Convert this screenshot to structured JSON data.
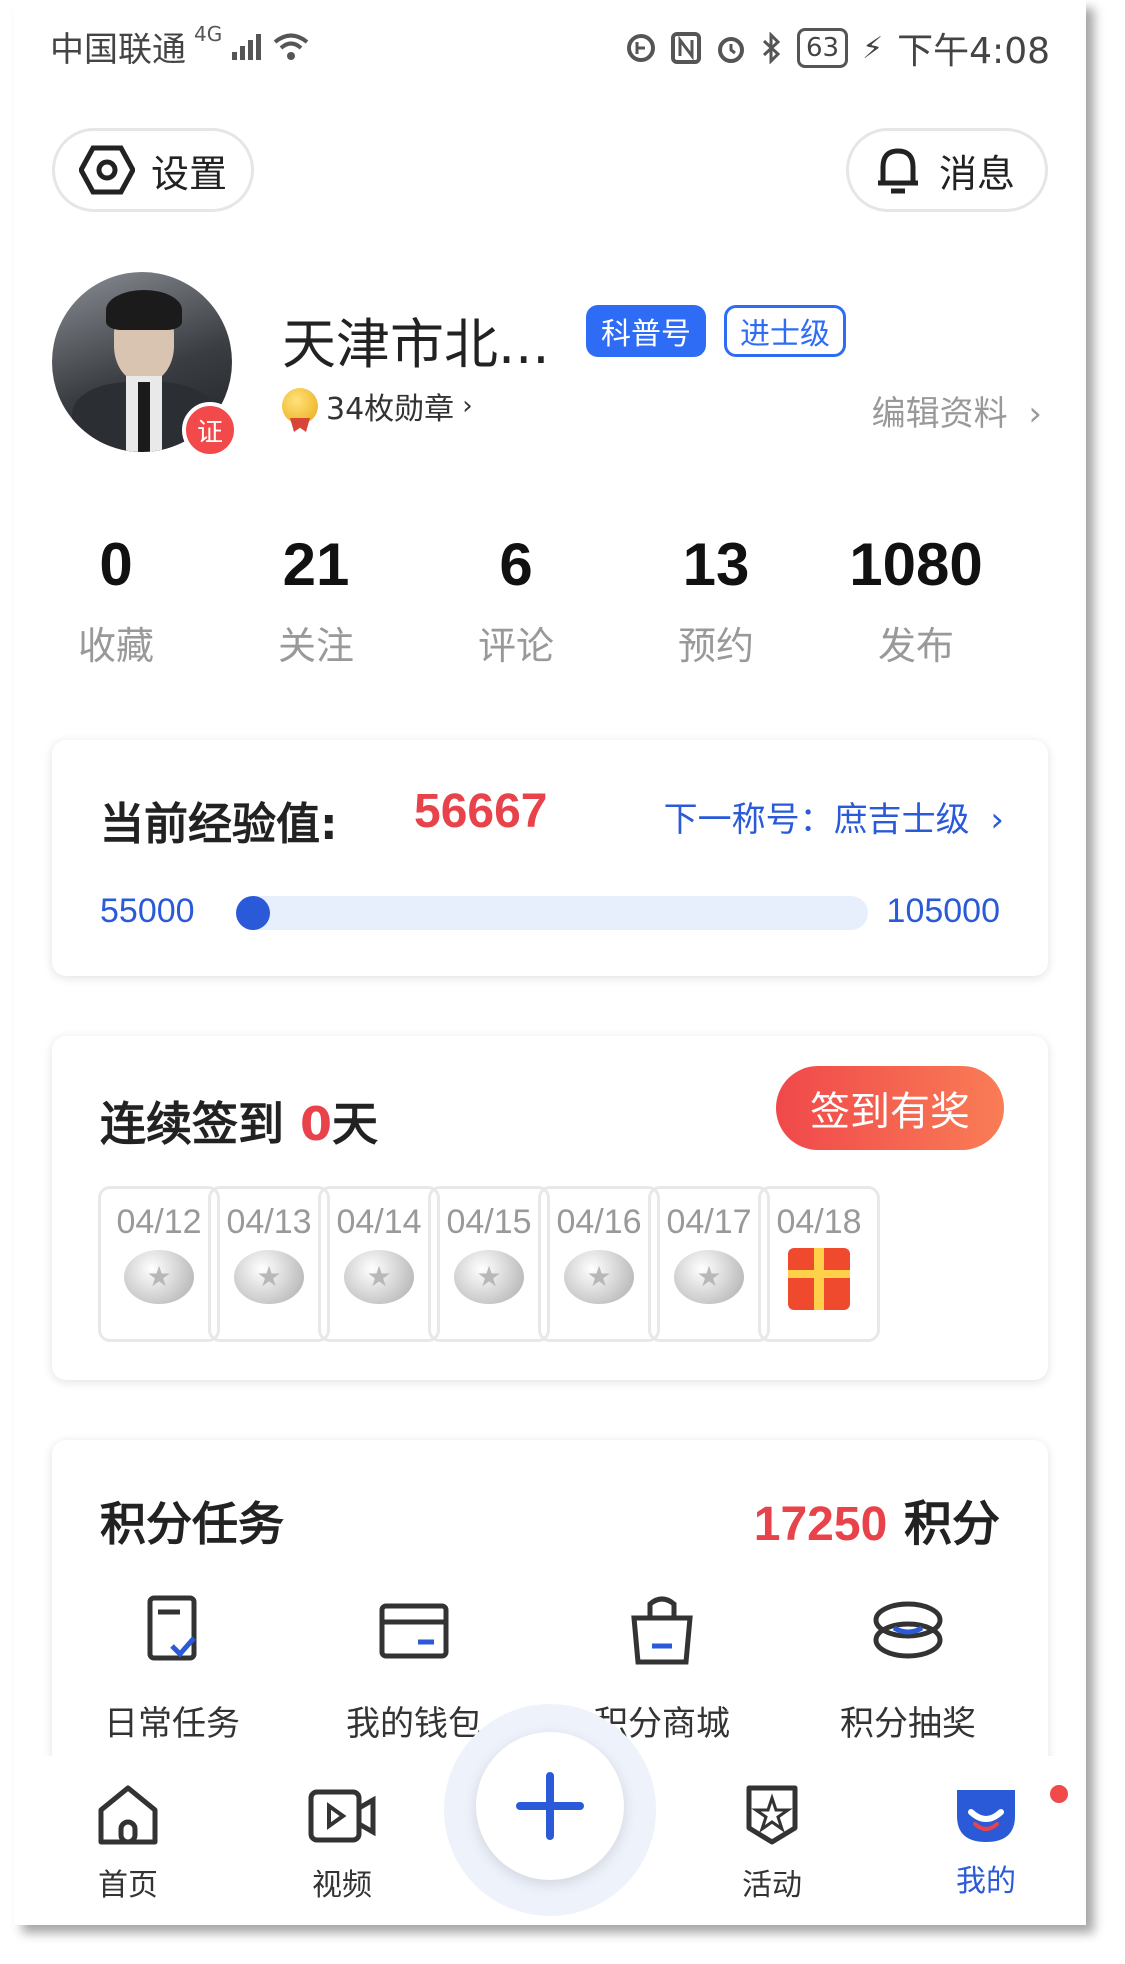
{
  "status_bar": {
    "carrier": "中国联通",
    "network": "4G",
    "battery": "63",
    "time": "下午4:08"
  },
  "top_bar": {
    "settings_label": "设置",
    "messages_label": "消息"
  },
  "profile": {
    "username": "天津市北...",
    "cert_badge": "证",
    "tags": [
      "科普号",
      "进士级"
    ],
    "medals": "34枚勋章",
    "edit_label": "编辑资料"
  },
  "stats": [
    {
      "value": "0",
      "label": "收藏"
    },
    {
      "value": "21",
      "label": "关注"
    },
    {
      "value": "6",
      "label": "评论"
    },
    {
      "value": "13",
      "label": "预约"
    },
    {
      "value": "1080",
      "label": "发布"
    }
  ],
  "experience": {
    "title": "当前经验值:",
    "value": "56667",
    "next_title": "下一称号：庶吉士级",
    "min": "55000",
    "max": "105000",
    "progress_fraction": 0.033
  },
  "checkin": {
    "title_prefix": "连续签到 ",
    "days": "0",
    "title_suffix": "天",
    "button_label": "签到有奖",
    "dates": [
      "04/12",
      "04/13",
      "04/14",
      "04/15",
      "04/16",
      "04/17",
      "04/18"
    ]
  },
  "points_tasks": {
    "title": "积分任务",
    "points": "17250",
    "points_unit": "积分",
    "items": [
      {
        "label": "日常任务",
        "icon": "checklist-icon"
      },
      {
        "label": "我的钱包",
        "icon": "wallet-icon"
      },
      {
        "label": "积分商城",
        "icon": "shopping-bag-icon"
      },
      {
        "label": "积分抽奖",
        "icon": "lottery-icon"
      }
    ]
  },
  "bottom_nav": {
    "items": [
      {
        "label": "首页",
        "icon": "home-icon"
      },
      {
        "label": "视频",
        "icon": "video-icon"
      },
      {
        "label": "活动",
        "icon": "activity-badge-icon"
      },
      {
        "label": "我的",
        "icon": "profile-icon"
      }
    ],
    "active": "我的",
    "accent": "#2a5ad8"
  }
}
